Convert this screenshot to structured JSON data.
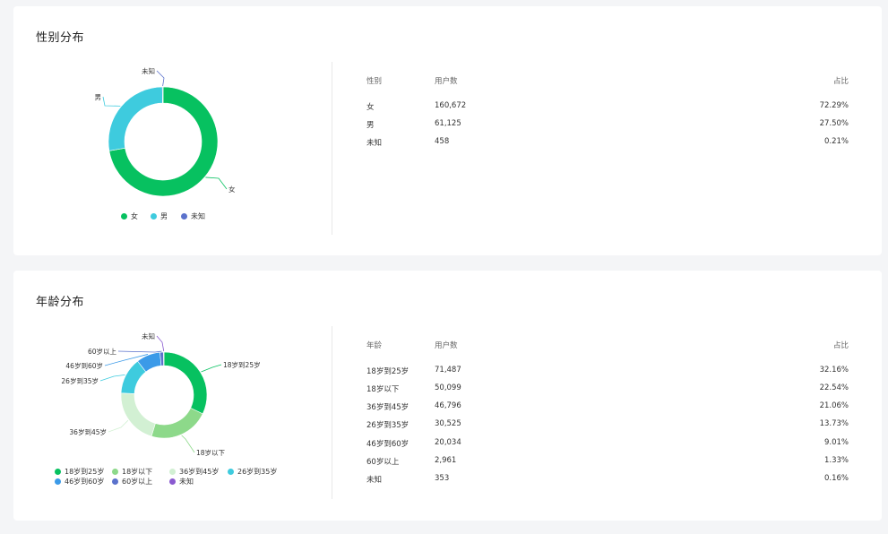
{
  "gender": {
    "title": "性别分布",
    "table": {
      "headers": [
        "性别",
        "用户数",
        "占比"
      ],
      "rows": [
        [
          "女",
          "160,672",
          "72.29%"
        ],
        [
          "男",
          "61,125",
          "27.50%"
        ],
        [
          "未知",
          "458",
          "0.21%"
        ]
      ]
    },
    "legend": [
      {
        "label": "女",
        "color": "#07c160"
      },
      {
        "label": "男",
        "color": "#3ecbde"
      },
      {
        "label": "未知",
        "color": "#5b72cc"
      }
    ],
    "chart_data": {
      "type": "pie",
      "donut": true,
      "categories": [
        "女",
        "男",
        "未知"
      ],
      "values": [
        160672,
        61125,
        458
      ],
      "colors": [
        "#07c160",
        "#3ecbde",
        "#5b72cc"
      ]
    }
  },
  "age": {
    "title": "年龄分布",
    "table": {
      "headers": [
        "年龄",
        "用户数",
        "占比"
      ],
      "rows": [
        [
          "18岁到25岁",
          "71,487",
          "32.16%"
        ],
        [
          "18岁以下",
          "50,099",
          "22.54%"
        ],
        [
          "36岁到45岁",
          "46,796",
          "21.06%"
        ],
        [
          "26岁到35岁",
          "30,525",
          "13.73%"
        ],
        [
          "46岁到60岁",
          "20,034",
          "9.01%"
        ],
        [
          "60岁以上",
          "2,961",
          "1.33%"
        ],
        [
          "未知",
          "353",
          "0.16%"
        ]
      ]
    },
    "legend": [
      {
        "label": "18岁到25岁",
        "color": "#07c160"
      },
      {
        "label": "18岁以下",
        "color": "#8dd98a"
      },
      {
        "label": "36岁到45岁",
        "color": "#d2f0d3"
      },
      {
        "label": "26岁到35岁",
        "color": "#3ecbde"
      },
      {
        "label": "46岁到60岁",
        "color": "#3b9ae8"
      },
      {
        "label": "60岁以上",
        "color": "#5b72cc"
      },
      {
        "label": "未知",
        "color": "#8a5ad0"
      }
    ],
    "chart_data": {
      "type": "pie",
      "donut": true,
      "categories": [
        "18岁到25岁",
        "18岁以下",
        "36岁到45岁",
        "26岁到35岁",
        "46岁到60岁",
        "60岁以上",
        "未知"
      ],
      "values": [
        71487,
        50099,
        46796,
        30525,
        20034,
        2961,
        353
      ],
      "colors": [
        "#07c160",
        "#8dd98a",
        "#d2f0d3",
        "#3ecbde",
        "#3b9ae8",
        "#5b72cc",
        "#8a5ad0"
      ]
    }
  }
}
